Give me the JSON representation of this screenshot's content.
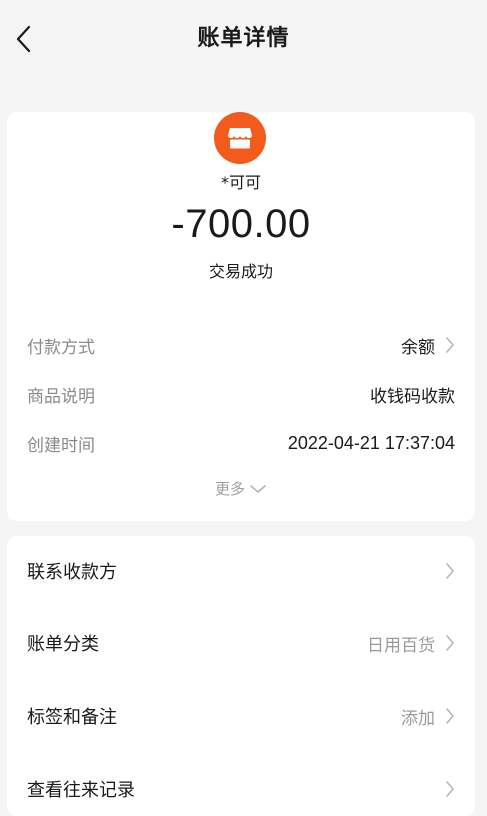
{
  "header": {
    "title": "账单详情"
  },
  "transaction": {
    "payee": "*可可",
    "amount": "-700.00",
    "status": "交易成功",
    "logo_icon": "store-icon",
    "logo_color": "#f25b1c"
  },
  "details": [
    {
      "label": "付款方式",
      "value": "余额",
      "has_arrow": true
    },
    {
      "label": "商品说明",
      "value": "收钱码收款",
      "has_arrow": false
    },
    {
      "label": "创建时间",
      "value": "2022-04-21 17:37:04",
      "has_arrow": false
    }
  ],
  "more_label": "更多",
  "menu": [
    {
      "label": "联系收款方",
      "value": ""
    },
    {
      "label": "账单分类",
      "value": "日用百货"
    },
    {
      "label": "标签和备注",
      "value": "添加"
    },
    {
      "label": "查看往来记录",
      "value": ""
    }
  ]
}
